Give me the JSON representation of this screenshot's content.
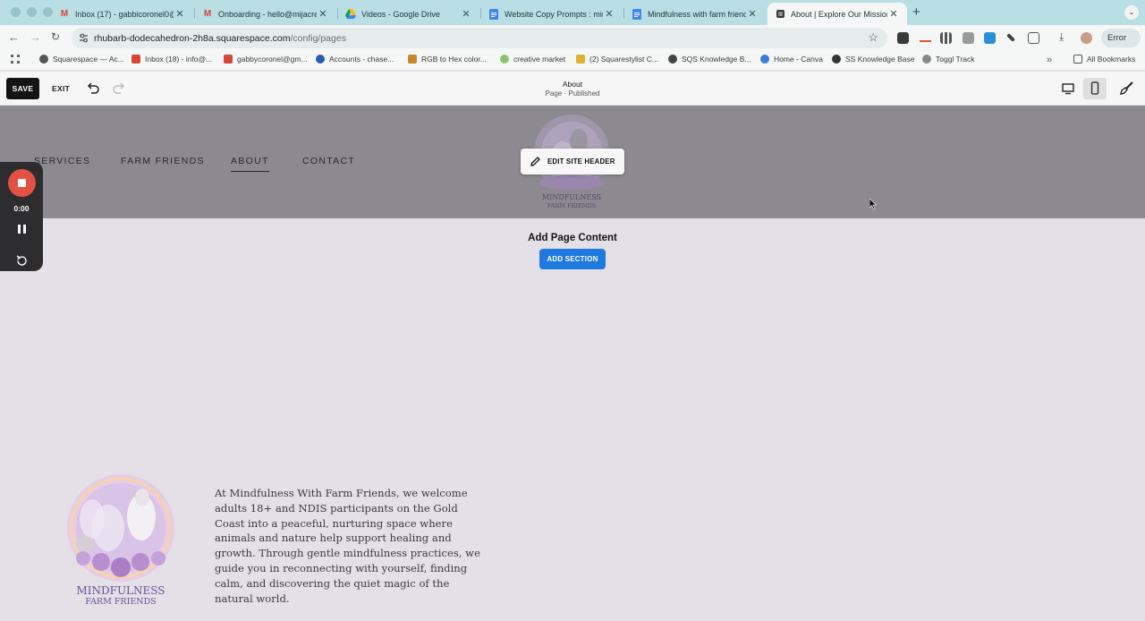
{
  "browser": {
    "tabs": [
      {
        "title": "Inbox (17) - gabbicoronel0@g",
        "icon": "gmail-icon",
        "active": false
      },
      {
        "title": "Onboarding - hello@mijacrea",
        "icon": "gmail-icon",
        "active": false
      },
      {
        "title": "Videos - Google Drive",
        "icon": "google-drive-icon",
        "active": false
      },
      {
        "title": "Website Copy Prompts : mind",
        "icon": "google-docs-icon",
        "active": false
      },
      {
        "title": "Mindfulness with farm friends",
        "icon": "google-docs-icon",
        "active": false
      },
      {
        "title": "About | Explore Our Mission",
        "icon": "squarespace-icon",
        "active": true
      }
    ],
    "url_host": "rhubarb-dodecahedron-2h8a.squarespace.com",
    "url_path": "/config/pages",
    "profile_button": "Error",
    "bookmarks": [
      {
        "label": "Squarespace — Ac...",
        "color": "#555555"
      },
      {
        "label": "Inbox (18) - info@...",
        "color": "#d44638"
      },
      {
        "label": "gabbycoronel@gm...",
        "color": "#d44638"
      },
      {
        "label": "Accounts - chase...",
        "color": "#2a5ca8"
      },
      {
        "label": "RGB to Hex color...",
        "color": "#c58a2a"
      },
      {
        "label": "creative market",
        "color": "#8ac46a"
      },
      {
        "label": "(2) Squarestylist C...",
        "color": "#e0b030"
      },
      {
        "label": "SQS Knowledge B...",
        "color": "#444444"
      },
      {
        "label": "Home - Canva",
        "color": "#3a7be0"
      },
      {
        "label": "SS Knowledge Base",
        "color": "#333333"
      },
      {
        "label": "Toggl Track",
        "color": "#888888"
      }
    ],
    "all_bookmarks": "All Bookmarks"
  },
  "editor": {
    "save_label": "SAVE",
    "exit_label": "EXIT",
    "page_title": "About",
    "page_status": "Page · Published"
  },
  "site_header": {
    "nav": [
      {
        "label": "SERVICES",
        "active": false
      },
      {
        "label": "FARM FRIENDS",
        "active": false
      },
      {
        "label": "ABOUT",
        "active": true
      },
      {
        "label": "CONTACT",
        "active": false
      }
    ],
    "edit_button": "EDIT SITE HEADER",
    "logo_text": [
      "MINDFULNESS",
      "FARM FRIENDS"
    ]
  },
  "recorder": {
    "time": "0:00"
  },
  "content": {
    "add_title": "Add Page Content",
    "add_button": "ADD SECTION",
    "about_paragraph": "At Mindfulness With Farm Friends, we welcome adults 18+ and NDIS participants on the Gold Coast into a peaceful, nurturing space where animals and nature help support healing and growth. Through gentle mindfulness practices, we guide you in reconnecting with yourself, finding calm, and discovering the quiet magic of the natural world."
  },
  "colors": {
    "tab_strip": "#b9dfe4",
    "header_bg": "#8c8a90",
    "page_bg": "#e4e0e8",
    "accent_blue": "#1f7ae0",
    "record_red": "#e25244"
  }
}
